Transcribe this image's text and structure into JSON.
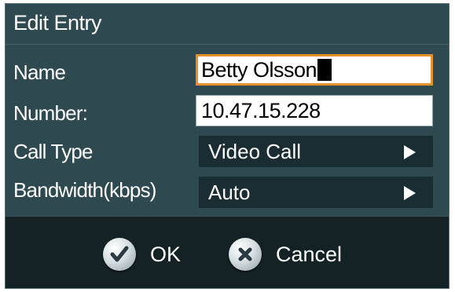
{
  "dialog": {
    "title": "Edit Entry"
  },
  "fields": {
    "name_label": "Name",
    "name_value": "Betty Olsson",
    "number_label": "Number:",
    "number_value": "10.47.15.228",
    "call_type_label": "Call Type",
    "call_type_value": "Video Call",
    "bandwidth_label": "Bandwidth(kbps)",
    "bandwidth_value": "Auto"
  },
  "buttons": {
    "ok_label": "OK",
    "cancel_label": "Cancel"
  },
  "icons": {
    "ok": "checkmark-icon",
    "cancel": "x-icon",
    "selector_arrow": "triangle-right-icon"
  },
  "colors": {
    "dialog_bg": "#2e4a50",
    "footer_bg": "#142226",
    "selector_bg": "#1a2d32",
    "focus_border": "#e8912a"
  }
}
